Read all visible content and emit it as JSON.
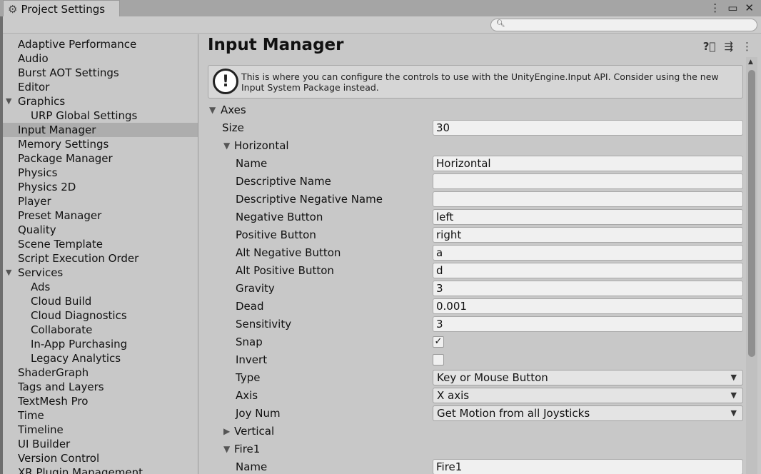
{
  "window": {
    "tab_title": "Project Settings",
    "tab_icon": "gear-icon",
    "controls": [
      "more-vertical-icon",
      "maximize-icon",
      "close-icon"
    ]
  },
  "search": {
    "placeholder": "",
    "value": ""
  },
  "sidebar": {
    "items": [
      {
        "label": "Adaptive Performance",
        "indent": 0,
        "caret": ""
      },
      {
        "label": "Audio",
        "indent": 0,
        "caret": ""
      },
      {
        "label": "Burst AOT Settings",
        "indent": 0,
        "caret": ""
      },
      {
        "label": "Editor",
        "indent": 0,
        "caret": ""
      },
      {
        "label": "Graphics",
        "indent": 0,
        "caret": "expanded"
      },
      {
        "label": "URP Global Settings",
        "indent": 1,
        "caret": ""
      },
      {
        "label": "Input Manager",
        "indent": 0,
        "caret": "",
        "selected": true
      },
      {
        "label": "Memory Settings",
        "indent": 0,
        "caret": ""
      },
      {
        "label": "Package Manager",
        "indent": 0,
        "caret": ""
      },
      {
        "label": "Physics",
        "indent": 0,
        "caret": ""
      },
      {
        "label": "Physics 2D",
        "indent": 0,
        "caret": ""
      },
      {
        "label": "Player",
        "indent": 0,
        "caret": ""
      },
      {
        "label": "Preset Manager",
        "indent": 0,
        "caret": ""
      },
      {
        "label": "Quality",
        "indent": 0,
        "caret": ""
      },
      {
        "label": "Scene Template",
        "indent": 0,
        "caret": ""
      },
      {
        "label": "Script Execution Order",
        "indent": 0,
        "caret": ""
      },
      {
        "label": "Services",
        "indent": 0,
        "caret": "expanded"
      },
      {
        "label": "Ads",
        "indent": 1,
        "caret": ""
      },
      {
        "label": "Cloud Build",
        "indent": 1,
        "caret": ""
      },
      {
        "label": "Cloud Diagnostics",
        "indent": 1,
        "caret": ""
      },
      {
        "label": "Collaborate",
        "indent": 1,
        "caret": ""
      },
      {
        "label": "In-App Purchasing",
        "indent": 1,
        "caret": ""
      },
      {
        "label": "Legacy Analytics",
        "indent": 1,
        "caret": ""
      },
      {
        "label": "ShaderGraph",
        "indent": 0,
        "caret": ""
      },
      {
        "label": "Tags and Layers",
        "indent": 0,
        "caret": ""
      },
      {
        "label": "TextMesh Pro",
        "indent": 0,
        "caret": ""
      },
      {
        "label": "Time",
        "indent": 0,
        "caret": ""
      },
      {
        "label": "Timeline",
        "indent": 0,
        "caret": ""
      },
      {
        "label": "UI Builder",
        "indent": 0,
        "caret": ""
      },
      {
        "label": "Version Control",
        "indent": 0,
        "caret": ""
      },
      {
        "label": "XR Plugin Management",
        "indent": 0,
        "caret": ""
      }
    ]
  },
  "main": {
    "title": "Input Manager",
    "header_icons": [
      "help-icon",
      "preset-sliders-icon",
      "more-vertical-icon"
    ],
    "help_text": "This is where you can configure the controls to use with the UnityEngine.Input API. Consider using the new Input System Package instead.",
    "axes_label": "Axes",
    "size_label": "Size",
    "size_value": "30",
    "horizontal": {
      "label": "Horizontal",
      "fields": {
        "name": {
          "label": "Name",
          "value": "Horizontal"
        },
        "descriptive_name": {
          "label": "Descriptive Name",
          "value": ""
        },
        "descriptive_negative_name": {
          "label": "Descriptive Negative Name",
          "value": ""
        },
        "negative_button": {
          "label": "Negative Button",
          "value": "left"
        },
        "positive_button": {
          "label": "Positive Button",
          "value": "right"
        },
        "alt_negative_button": {
          "label": "Alt Negative Button",
          "value": "a"
        },
        "alt_positive_button": {
          "label": "Alt Positive Button",
          "value": "d"
        },
        "gravity": {
          "label": "Gravity",
          "value": "3"
        },
        "dead": {
          "label": "Dead",
          "value": "0.001"
        },
        "sensitivity": {
          "label": "Sensitivity",
          "value": "3"
        }
      },
      "snap": {
        "label": "Snap",
        "checked": true
      },
      "invert": {
        "label": "Invert",
        "checked": false
      },
      "type": {
        "label": "Type",
        "value": "Key or Mouse Button"
      },
      "axis": {
        "label": "Axis",
        "value": "X axis"
      },
      "joy_num": {
        "label": "Joy Num",
        "value": "Get Motion from all Joysticks"
      }
    },
    "vertical_label": "Vertical",
    "fire1": {
      "label": "Fire1",
      "name_label": "Name",
      "name_value": "Fire1"
    }
  }
}
